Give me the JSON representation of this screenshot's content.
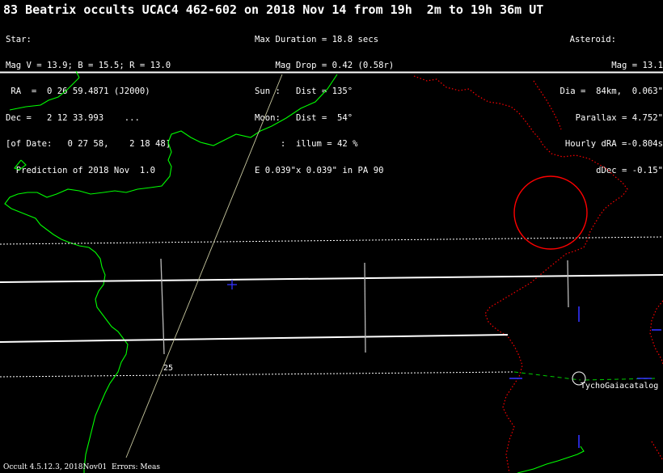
{
  "title": "83 Beatrix occults UCAC4 462-602 on 2018 Nov 14 from 19h  2m to 19h 36m UT",
  "star_info": {
    "heading": "Star:",
    "mag": "Mag V = 13.9; B = 15.5; R = 13.0",
    "ra": " RA  =  0 26 59.4871 (J2000)",
    "dec": "Dec =   2 12 33.993    ...",
    "of_date": "[of Date:   0 27 58,    2 18 48]",
    "prediction": "  Prediction of 2018 Nov  1.0"
  },
  "circumstances": {
    "max_duration": "Max Duration = 18.8 secs",
    "mag_drop": "    Mag Drop = 0.42 (0.58r)",
    "sun": "Sun :   Dist = 135°",
    "moon": "Moon:   Dist =  54°",
    "illum": "     :  illum = 42 %",
    "error_ellipse": "E 0.039\"x 0.039\" in PA 90"
  },
  "asteroid": {
    "heading": "Asteroid:",
    "mag": "Mag = 13.1",
    "dia": "Dia =  84km,  0.063\"",
    "parallax": "Parallax = 4.752\"",
    "hourly_dra": "Hourly dRA =-0.804s",
    "ddec": "dDec = -0.15\""
  },
  "map": {
    "colors": {
      "coastline": "#00ff00",
      "border": "#ff0000",
      "path_limits": "#ffffff",
      "sigma_limits": "#ffffff",
      "ground_track": "#c8c8a0",
      "site_marker": "#0000ff",
      "star_circle": "#ff0000",
      "dashed_green": "#00cc00"
    },
    "time_label": "25",
    "site_label": "TychoGaiacatalog"
  },
  "footer": "Occult 4.5.12.3, 2018Nov01  Errors: Meas"
}
